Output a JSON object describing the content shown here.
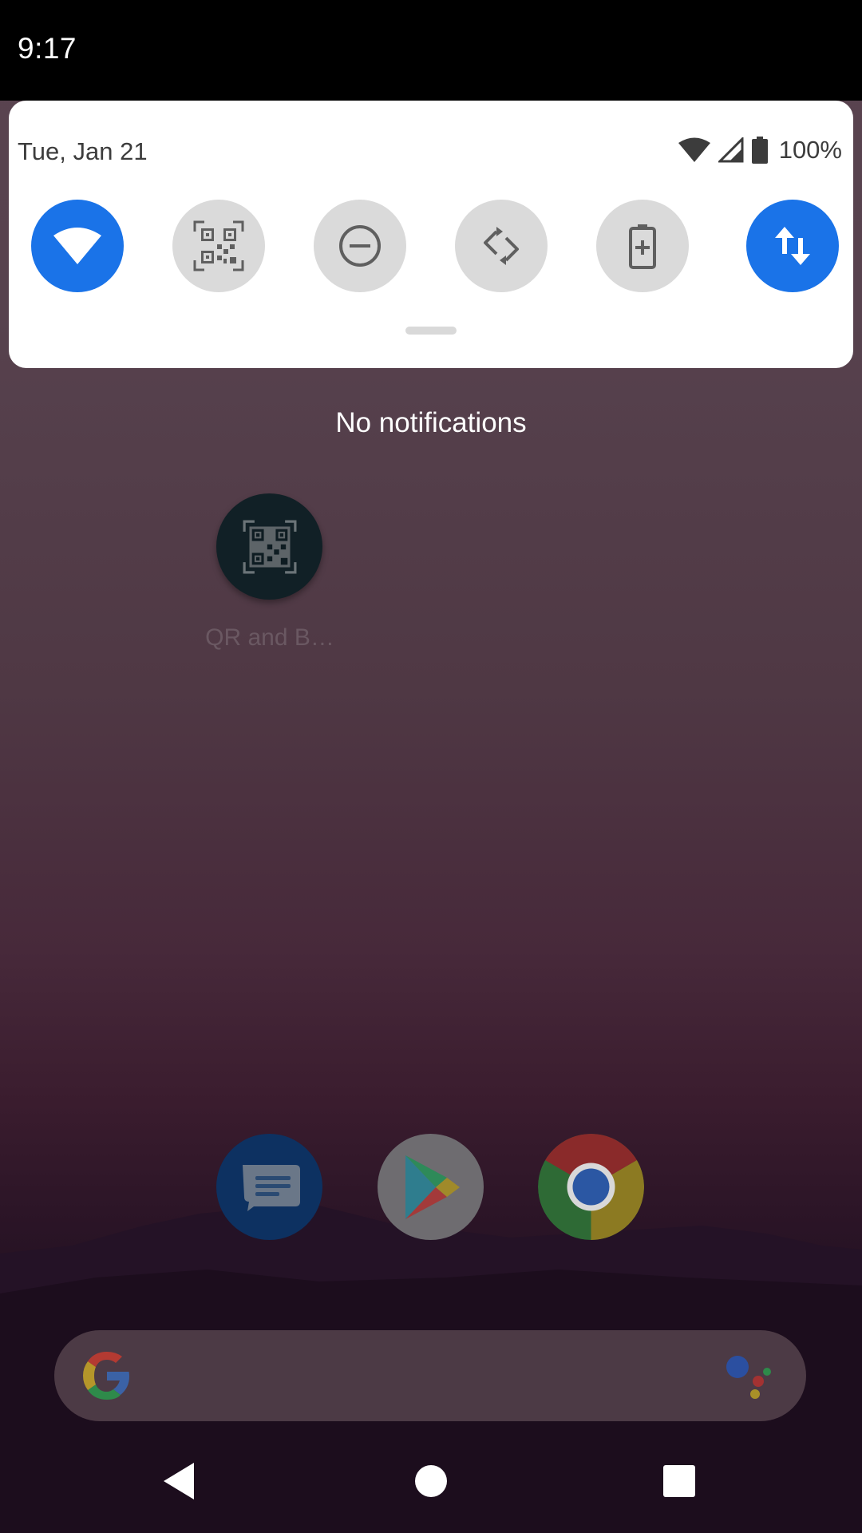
{
  "status_bar": {
    "time": "9:17"
  },
  "quick_settings": {
    "date": "Tue, Jan 21",
    "battery_percent": "100%",
    "tiles": [
      {
        "name": "wifi",
        "state": "on"
      },
      {
        "name": "qr-scanner",
        "state": "off"
      },
      {
        "name": "do-not-disturb",
        "state": "off"
      },
      {
        "name": "auto-rotate",
        "state": "off"
      },
      {
        "name": "battery-saver",
        "state": "off"
      },
      {
        "name": "mobile-data",
        "state": "on"
      }
    ]
  },
  "notifications": {
    "empty_text": "No notifications"
  },
  "home": {
    "app_label": "QR and B…"
  },
  "dock": [
    "messages",
    "play-store",
    "chrome"
  ],
  "colors": {
    "tile_on": "#1a73e8",
    "tile_off": "#dadada",
    "panel": "#ffffff"
  }
}
